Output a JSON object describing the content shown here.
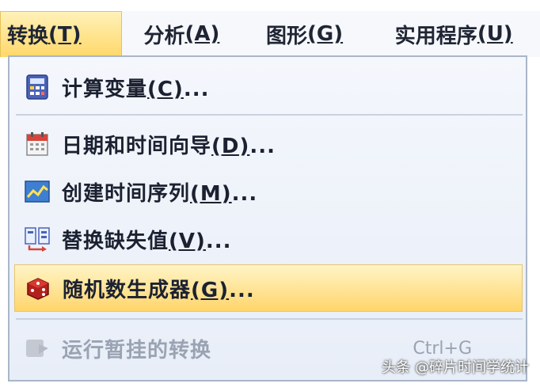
{
  "menubar": {
    "items": [
      {
        "label": "转换",
        "mnemonic": "(T)"
      },
      {
        "label": "分析",
        "mnemonic": "(A)"
      },
      {
        "label": "图形",
        "mnemonic": "(G)"
      },
      {
        "label": "实用程序",
        "mnemonic": "(U)"
      }
    ]
  },
  "dropdown": {
    "items": [
      {
        "label": "计算变量",
        "mnemonic": "(C)",
        "suffix": "...",
        "icon": "calculator-icon"
      },
      {
        "label": "日期和时间向导",
        "mnemonic": "(D)",
        "suffix": "...",
        "icon": "calendar-icon"
      },
      {
        "label": "创建时间序列",
        "mnemonic": "(M)",
        "suffix": "...",
        "icon": "chart-icon"
      },
      {
        "label": "替换缺失值",
        "mnemonic": "(V)",
        "suffix": "...",
        "icon": "replace-icon"
      },
      {
        "label": "随机数生成器",
        "mnemonic": "(G)",
        "suffix": "...",
        "icon": "dice-icon"
      },
      {
        "label": "运行暂挂的转换",
        "mnemonic": "",
        "suffix": "",
        "shortcut": "Ctrl+G",
        "icon": "run-pending-icon"
      }
    ]
  },
  "watermark": "头条 @碎片时间学统计",
  "colors": {
    "highlight": "#ffd56b",
    "menu_bg": "#eef2f9",
    "disabled_text": "#9aa3b2"
  }
}
